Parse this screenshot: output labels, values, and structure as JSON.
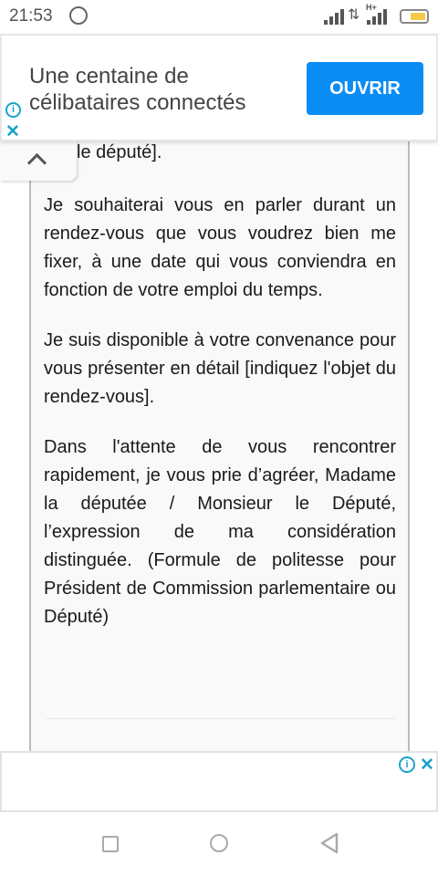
{
  "status": {
    "time": "21:53",
    "network": "H+"
  },
  "top_ad": {
    "text": "Une centaine de célibataires connectés",
    "button": "OUVRIR",
    "info_icon": "i",
    "close_icon": "✕"
  },
  "article": {
    "partial_line": "le député].",
    "paragraphs": [
      "Je souhaiterai vous en parler durant un rendez-vous que vous voudrez bien me fixer, à une date qui vous conviendra en fonction de votre emploi du temps.",
      "Je suis disponible à votre convenance pour vous présenter en détail [indiquez l'objet du rendez-vous].",
      "Dans l'attente de vous rencontrer rapidement, je vous prie d’agréer, Madame la députée / Monsieur le Député, l’expression de ma considération distinguée. (Formule de politesse pour Président de Commission parlementaire ou Député)"
    ]
  },
  "bottom_ad": {
    "info_icon": "i",
    "close_icon": "✕"
  },
  "colors": {
    "accent": "#0a8cf5",
    "adchoices": "#1aa3c8"
  }
}
